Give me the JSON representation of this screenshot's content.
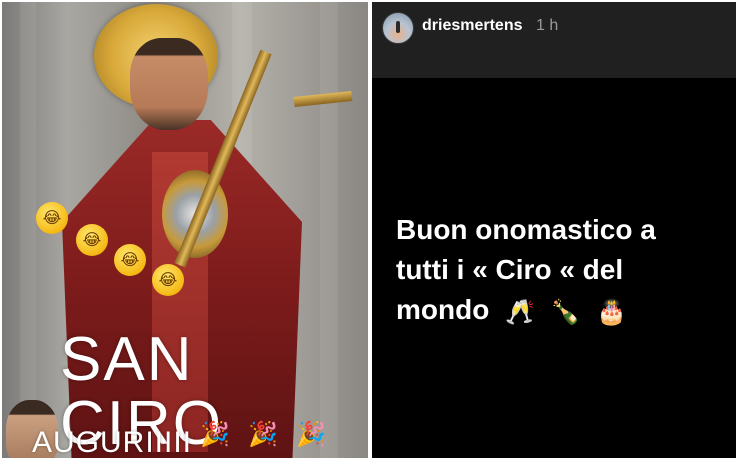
{
  "left_image": {
    "overlay_title": "SAN CIRO",
    "overlay_subtitle": "AUGURIIIII",
    "emoji_laugh": "😂",
    "emoji_party": "🎉"
  },
  "story": {
    "username": "driesmertens",
    "timestamp": "1 h",
    "lines": [
      "Buon onomastico a",
      "tutti i « Ciro «  del",
      "mondo"
    ],
    "emojis": [
      "🥂",
      "🍾",
      "🎂"
    ]
  },
  "colors": {
    "story_header_bg": "#202020",
    "story_bg": "#000000",
    "text_primary": "#ffffff",
    "text_muted": "#9a9a9a"
  }
}
